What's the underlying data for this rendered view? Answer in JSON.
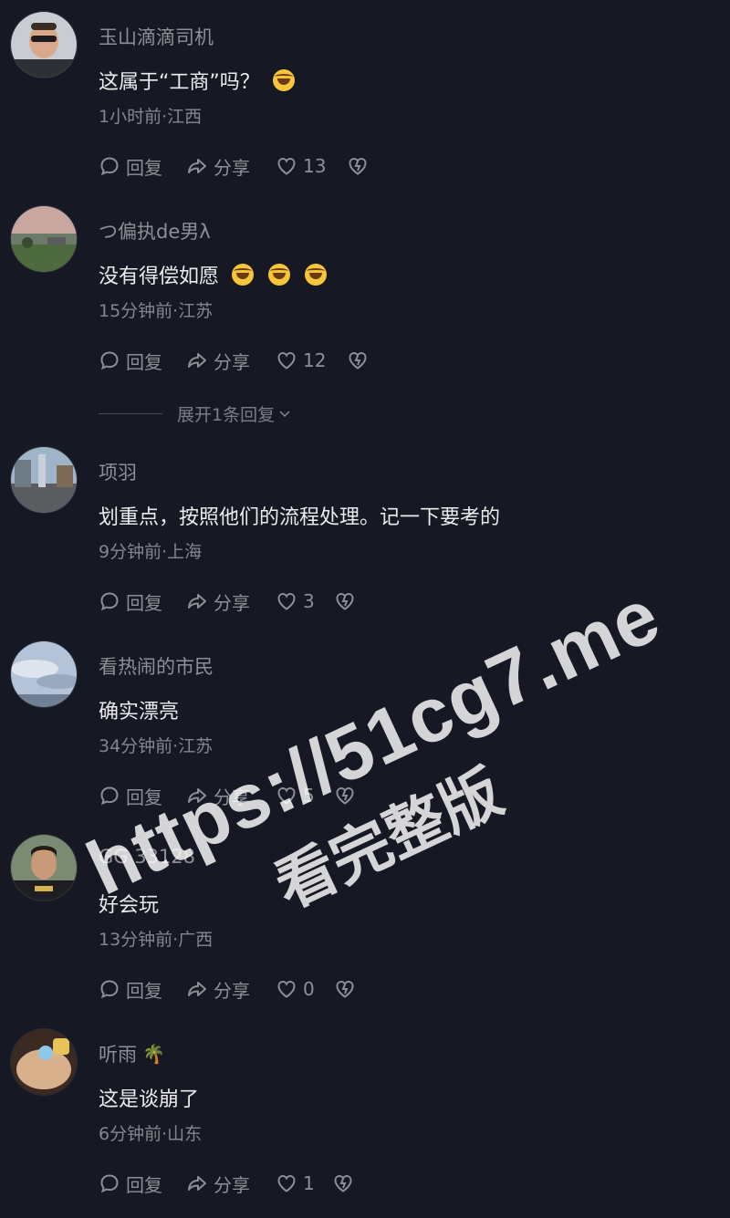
{
  "actions": {
    "reply": "回复",
    "share": "分享"
  },
  "comments": [
    {
      "username": "玉山滴滴司机",
      "text": "这属于“工商”吗？",
      "emojis": 1,
      "meta": "1小时前·江西",
      "likes": "13"
    },
    {
      "username": "つ偏执de男λ",
      "text": "没有得偿如愿",
      "emojis": 3,
      "meta": "15分钟前·江苏",
      "likes": "12"
    },
    {
      "username": "项羽",
      "text": "划重点，按照他们的流程处理。记一下要考的",
      "emojis": 0,
      "meta": "9分钟前·上海",
      "likes": "3"
    },
    {
      "username": "看热闹的市民",
      "text": "确实漂亮",
      "emojis": 0,
      "meta": "34分钟前·江苏",
      "likes": "5"
    },
    {
      "username": "GG 33128",
      "text": "好会玩",
      "emojis": 0,
      "meta": "13分钟前·广西",
      "likes": "0"
    },
    {
      "username": "听雨",
      "username_emoji": "🌴",
      "text": "这是谈崩了",
      "emojis": 0,
      "meta": "6分钟前·山东",
      "likes": "1"
    }
  ],
  "expand_replies": "展开1条回复",
  "watermark": {
    "line1": "https://51cg7.me",
    "line2": "看完整版"
  },
  "colors": {
    "background": "#161823",
    "text": "#ececee",
    "secondary": "#8e8f96",
    "emoji": "#f7c63a"
  }
}
